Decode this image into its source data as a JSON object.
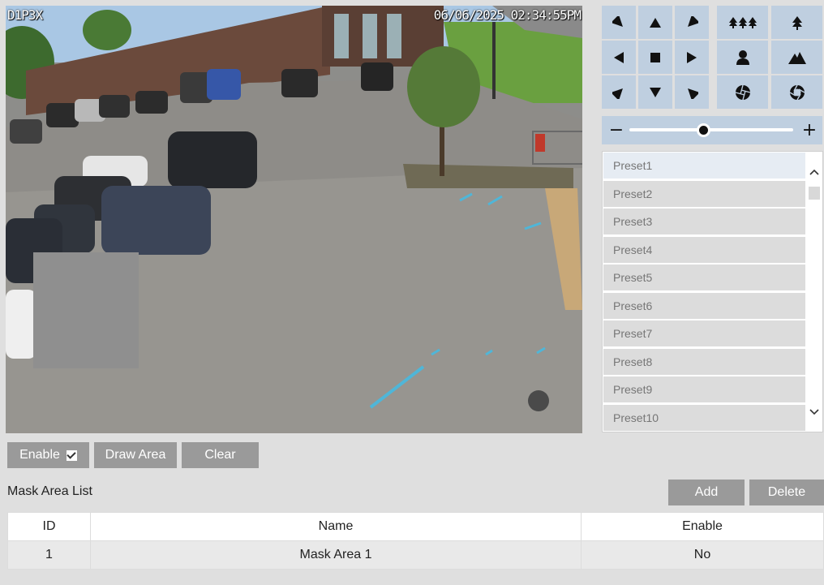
{
  "video": {
    "osd_channel": "D1P3X",
    "osd_timestamp": "06/06/2025 02:34:55PM"
  },
  "ptz": {
    "buttons": [
      {
        "icon": "arrow-down-right-icon"
      },
      {
        "icon": "arrow-up-icon"
      },
      {
        "icon": "arrow-down-left-icon"
      },
      {
        "icon": "zoom-out-trees-icon"
      },
      {
        "icon": "zoom-in-tree-icon"
      },
      {
        "icon": "arrow-left-icon"
      },
      {
        "icon": "stop-icon"
      },
      {
        "icon": "arrow-right-icon"
      },
      {
        "icon": "focus-near-person-icon"
      },
      {
        "icon": "focus-far-mountain-icon"
      },
      {
        "icon": "arrow-up-right-icon"
      },
      {
        "icon": "arrow-down-icon"
      },
      {
        "icon": "arrow-up-left-icon"
      },
      {
        "icon": "iris-close-icon"
      },
      {
        "icon": "iris-open-icon"
      }
    ],
    "zoom_minus": "−",
    "zoom_plus": "+"
  },
  "presets": {
    "items": [
      "Preset1",
      "Preset2",
      "Preset3",
      "Preset4",
      "Preset5",
      "Preset6",
      "Preset7",
      "Preset8",
      "Preset9",
      "Preset10"
    ]
  },
  "mask": {
    "enable_label": "Enable",
    "enable_checked": true,
    "draw_area_label": "Draw Area",
    "clear_label": "Clear",
    "list_title": "Mask Area List",
    "add_label": "Add",
    "delete_label": "Delete",
    "table": {
      "headers": [
        "ID",
        "Name",
        "Enable"
      ],
      "rows": [
        [
          "1",
          "Mask Area 1",
          "No"
        ]
      ]
    }
  },
  "colors": {
    "ptz_button_bg": "#bfcfe0",
    "button_gray": "#9a9a9a",
    "page_bg": "#dfdfdf"
  }
}
